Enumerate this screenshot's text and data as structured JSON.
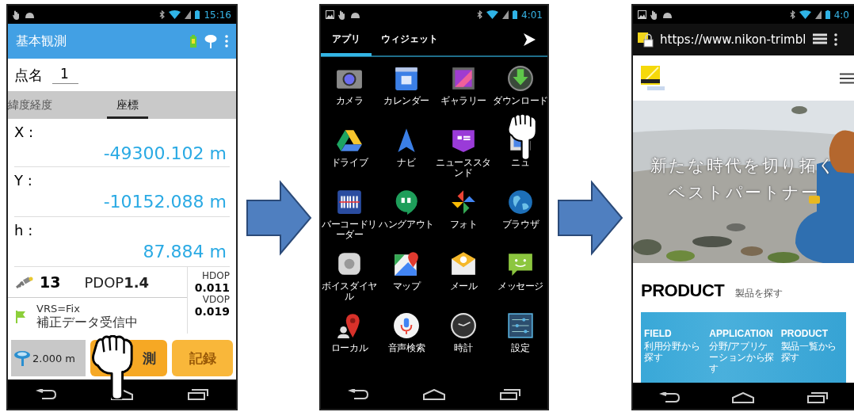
{
  "survey_screen": {
    "status_time": "15:16",
    "title": "基本観測",
    "point_name_label": "点名",
    "point_name": "1",
    "tabs": [
      {
        "label": "緯度経度",
        "selected": false
      },
      {
        "label": "座標",
        "selected": true
      }
    ],
    "coordinates": [
      {
        "label": "X :",
        "value": "-49300.102 m"
      },
      {
        "label": "Y :",
        "value": "-10152.088 m"
      },
      {
        "label": "h :",
        "value": "87.884 m"
      }
    ],
    "satellites": "13",
    "pdop": "PDOP**1.4**",
    "hdop_label": "HDOP",
    "hdop": "0.011",
    "vdop_label": "VDOP",
    "vdop": "0.019",
    "fix": "VRS=Fix",
    "correction": "補正データ受信中",
    "antenna_height": "2.000 m",
    "buttons": [
      {
        "label": "測",
        "disabled": false
      },
      {
        "label": "記録",
        "disabled": true
      }
    ]
  },
  "app_drawer": {
    "status_time": "4:01",
    "tabs": [
      {
        "label": "アプリ",
        "selected": true
      },
      {
        "label": "ウィジェット",
        "selected": false
      }
    ],
    "apps": [
      {
        "label": "カメラ"
      },
      {
        "label": "カレンダー"
      },
      {
        "label": "ギャラリー"
      },
      {
        "label": "ダウンロード"
      },
      {
        "label": "ドライブ"
      },
      {
        "label": "ナビ"
      },
      {
        "label": "ニューススタンド"
      },
      {
        "label": "ニュ"
      },
      {
        "label": "バーコードリーダー"
      },
      {
        "label": "ハングアウト"
      },
      {
        "label": "フォト"
      },
      {
        "label": "ブラウザ"
      },
      {
        "label": "ボイスダイヤル"
      },
      {
        "label": "マップ"
      },
      {
        "label": "メール"
      },
      {
        "label": "メッセージ"
      },
      {
        "label": "ローカル"
      },
      {
        "label": "音声検索"
      },
      {
        "label": "時計"
      },
      {
        "label": "設定"
      }
    ]
  },
  "browser_screen": {
    "status_time": "4:0",
    "url": "https://www.nikon-trimbl",
    "hero_lines": [
      "新たな時代を切り拓く",
      "ベストパートナー"
    ],
    "section_title": "PRODUCT",
    "section_subtitle": "製品を探す",
    "categories": [
      {
        "title": "FIELD",
        "caption": "利用分野から探す"
      },
      {
        "title": "APPLICATION",
        "caption": "分野/アプリケーションから探す"
      },
      {
        "title": "PRODUCT",
        "caption": "製品一覧から探す"
      }
    ]
  }
}
